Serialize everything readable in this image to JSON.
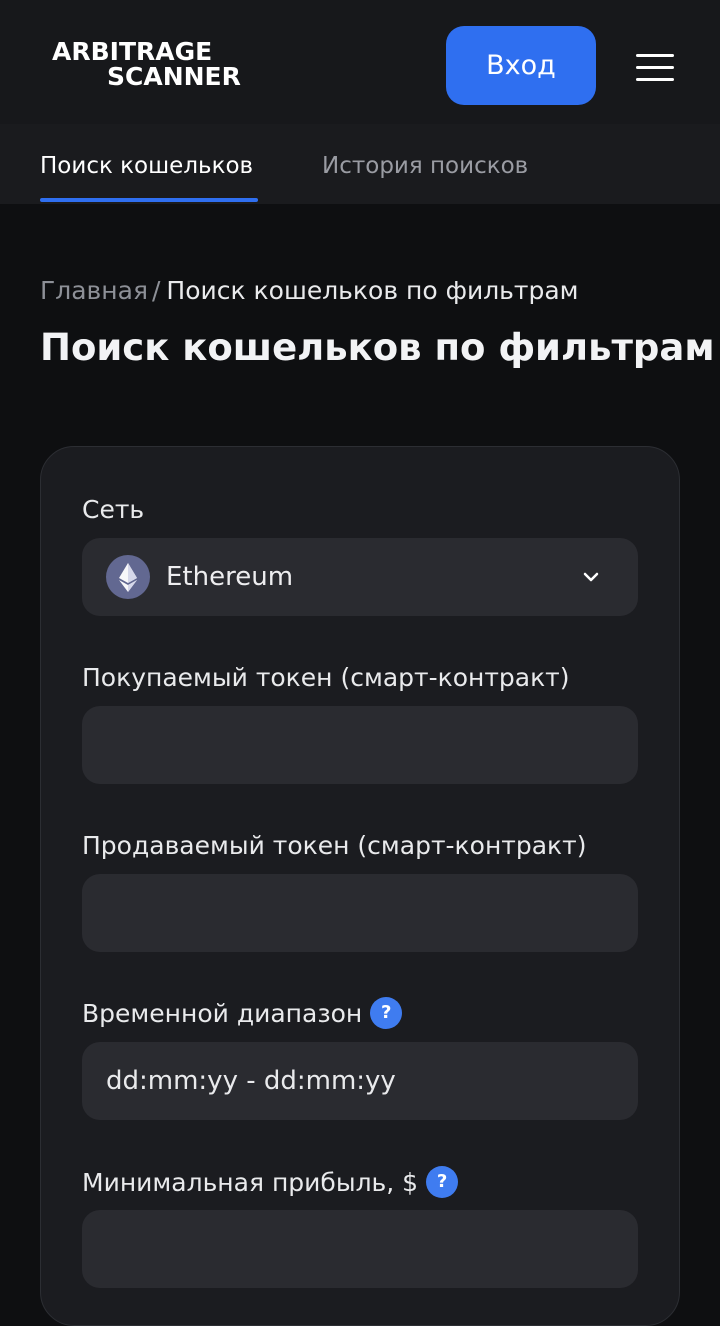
{
  "header": {
    "logo_line1": "ARBITRAGE",
    "logo_line2": "SCANNER",
    "login_label": "Вход",
    "menu_icon": "hamburger-menu-icon"
  },
  "tabs": [
    {
      "label": "Поиск кошельков",
      "active": true
    },
    {
      "label": "История поисков",
      "active": false
    }
  ],
  "breadcrumb": {
    "home": "Главная",
    "separator": "/",
    "current": "Поиск кошельков по фильтрам"
  },
  "page_title": "Поиск кошельков по фильтрам",
  "form": {
    "network": {
      "label": "Сеть",
      "selected": "Ethereum",
      "icon": "ethereum-icon"
    },
    "buy_token": {
      "label": "Покупаемый токен (смарт-контракт)",
      "value": ""
    },
    "sell_token": {
      "label": "Продаваемый токен (смарт-контракт)",
      "value": ""
    },
    "time_range": {
      "label": "Временной диапазон",
      "help": "?",
      "placeholder": "dd:mm:yy - dd:mm:yy"
    },
    "min_profit": {
      "label": "Минимальная прибыль, $",
      "help": "?",
      "value": ""
    }
  },
  "colors": {
    "accent": "#2f6ff0",
    "background": "#0e0f11",
    "card": "#1b1c20",
    "field": "#2a2b30"
  }
}
